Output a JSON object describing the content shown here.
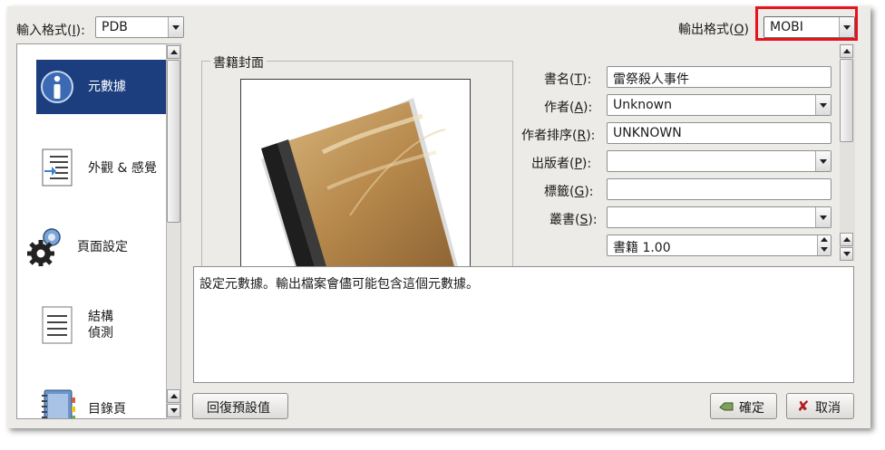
{
  "input_format": {
    "label": "輸入格式(",
    "mnemonic": "I",
    "label_end": "):",
    "value": "PDB"
  },
  "output_format": {
    "label": "輸出格式(",
    "mnemonic": "O",
    "label_end": ")",
    "value": "MOBI"
  },
  "sidebar": {
    "items": [
      {
        "label": "元數據",
        "icon": "info-icon",
        "selected": true
      },
      {
        "label": "外觀 & 感覺",
        "icon": "look-and-feel-icon"
      },
      {
        "label": "頁面設定",
        "icon": "page-setup-gears-icon"
      },
      {
        "label": "結構",
        "label2": "偵測",
        "icon": "structure-detect-icon"
      },
      {
        "label": "目錄頁",
        "icon": "toc-notebook-icon"
      }
    ]
  },
  "cover": {
    "title": "書籍封面"
  },
  "fields": {
    "title": {
      "label": "書名(",
      "mnemonic": "T",
      "label_end": "):",
      "value": "雷祭殺人事件"
    },
    "author": {
      "label": "作者(",
      "mnemonic": "A",
      "label_end": "):",
      "value": "Unknown"
    },
    "author_sort": {
      "label": "作者排序(",
      "mnemonic": "R",
      "label_end": "):",
      "value": "UNKNOWN"
    },
    "publisher": {
      "label": "出版者(",
      "mnemonic": "P",
      "label_end": "):",
      "value": ""
    },
    "tags": {
      "label": "標籤(",
      "mnemonic": "G",
      "label_end": "):",
      "value": ""
    },
    "series": {
      "label": "叢書(",
      "mnemonic": "S",
      "label_end": "):",
      "value": ""
    },
    "series_index": {
      "value": "書籍 1.00"
    }
  },
  "description": "設定元數據。輸出檔案會儘可能包含這個元數據。",
  "buttons": {
    "restore_defaults": "回復預設值",
    "ok": "確定",
    "cancel": "取消"
  },
  "colors": {
    "selection": "#1c3e7e",
    "highlight": "#e8121b"
  }
}
